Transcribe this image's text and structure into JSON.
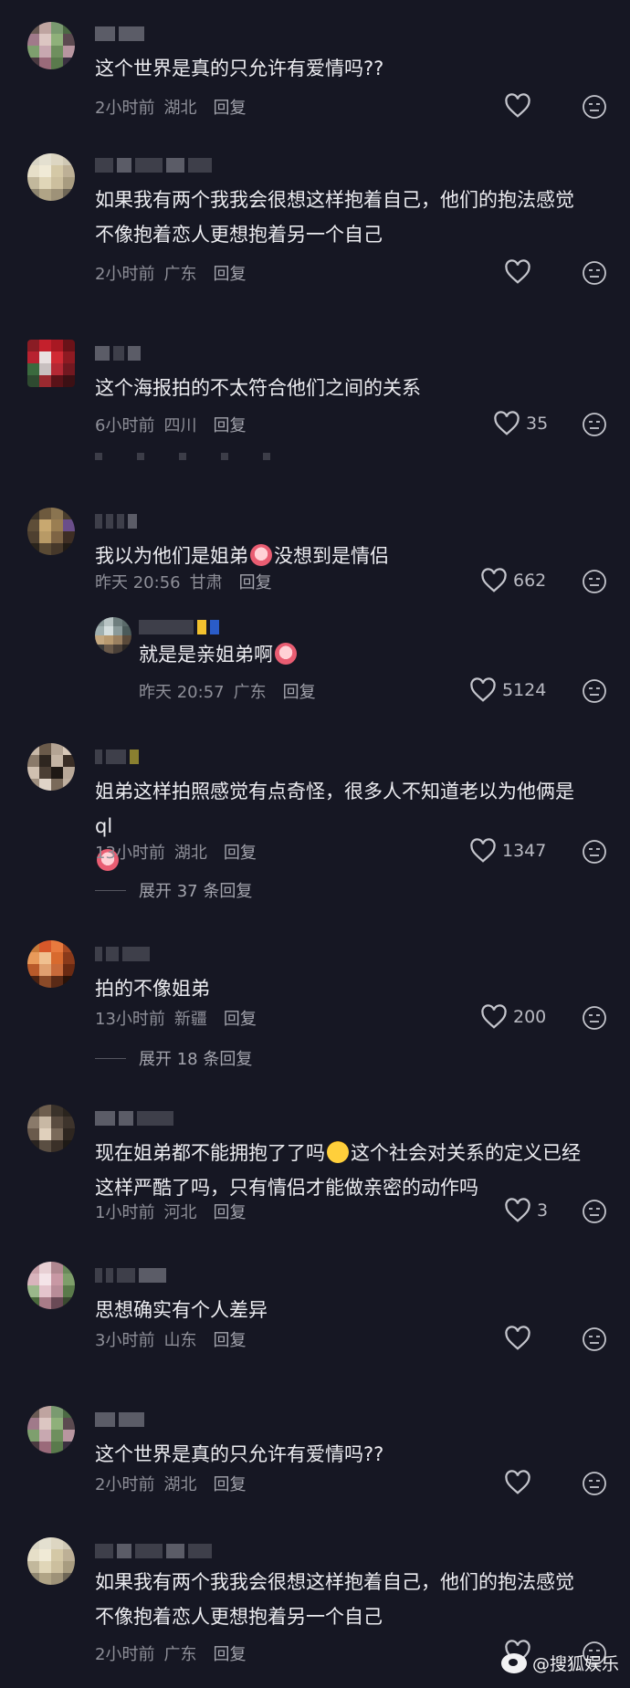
{
  "comments": [
    {
      "text": "这个世界是真的只允许有爱情吗??",
      "time": "2小时前",
      "location": "湖北",
      "reply": "回复",
      "likes": ""
    },
    {
      "text": "如果我有两个我我会很想这样抱着自己，他们的抱法感觉\n不像抱着恋人更想抱着另一个自己",
      "time": "2小时前",
      "location": "广东",
      "reply": "回复",
      "likes": ""
    },
    {
      "text": "这个海报拍的不太符合他们之间的关系",
      "time": "6小时前",
      "location": "四川",
      "reply": "回复",
      "likes": "35"
    },
    {
      "text_a": "我以为他们是姐弟",
      "text_b": "没想到是情侣",
      "time": "昨天 20:56",
      "location": "甘肃",
      "reply": "回复",
      "likes": "662"
    },
    {
      "text": "就是是亲姐弟啊",
      "time": "昨天 20:57",
      "location": "广东",
      "reply": "回复",
      "likes": "5124"
    },
    {
      "text": "姐弟这样拍照感觉有点奇怪，很多人不知道老以为他俩是ql",
      "time": "13小时前",
      "location": "湖北",
      "reply": "回复",
      "likes": "1347",
      "expand": "展开 37 条回复"
    },
    {
      "text": "拍的不像姐弟",
      "time": "13小时前",
      "location": "新疆",
      "reply": "回复",
      "likes": "200",
      "expand": "展开 18 条回复"
    },
    {
      "text_a": "现在姐弟都不能拥抱了了吗",
      "text_b": "这个社会对关系的定义已经\n这样严酷了吗，只有情侣才能做亲密的动作吗",
      "time": "1小时前",
      "location": "河北",
      "reply": "回复",
      "likes": "3"
    },
    {
      "text": "思想确实有个人差异",
      "time": "3小时前",
      "location": "山东",
      "reply": "回复",
      "likes": ""
    },
    {
      "text": "这个世界是真的只允许有爱情吗??",
      "time": "2小时前",
      "location": "湖北",
      "reply": "回复",
      "likes": ""
    },
    {
      "text": "如果我有两个我我会很想这样抱着自己，他们的抱法感觉\n不像抱着恋人更想抱着另一个自己",
      "time": "2小时前",
      "location": "广东",
      "reply": "回复",
      "likes": ""
    }
  ],
  "watermark": "@搜狐娱乐",
  "icons": {
    "like": "heart-icon",
    "dislike": "neutral-face-icon",
    "weibo": "weibo-logo-icon"
  }
}
